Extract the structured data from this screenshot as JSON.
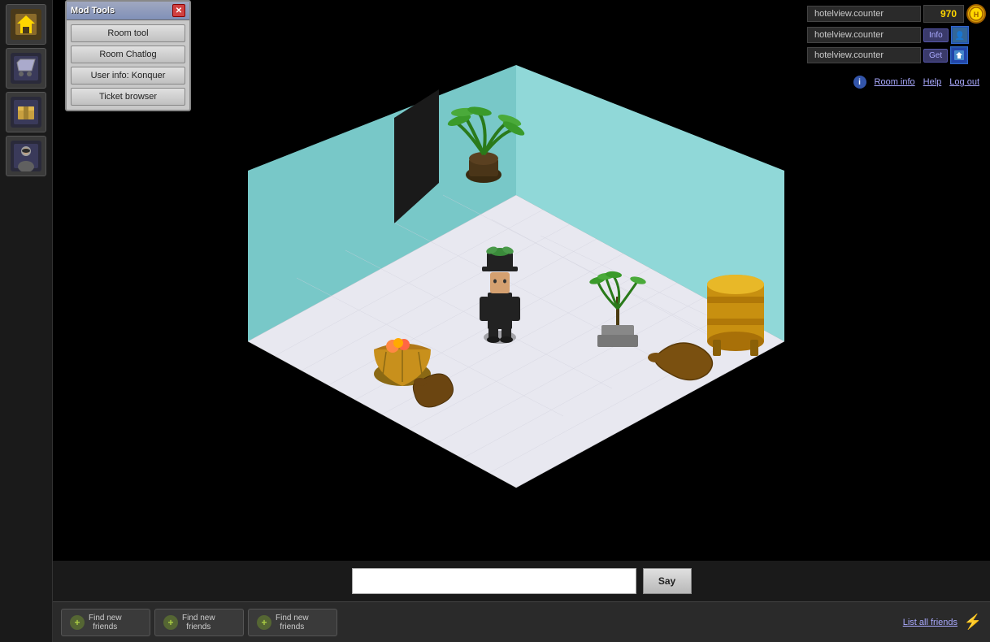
{
  "sidebar": {
    "icons": [
      {
        "name": "home-icon",
        "symbol": "🏠"
      },
      {
        "name": "shop-icon",
        "symbol": "🛒"
      },
      {
        "name": "inventory-icon",
        "symbol": "📦"
      },
      {
        "name": "avatar-icon",
        "symbol": "👤"
      }
    ]
  },
  "mod_tools": {
    "title": "Mod Tools",
    "close_label": "✕",
    "buttons": [
      {
        "name": "room-tool-btn",
        "label": "Room tool"
      },
      {
        "name": "room-chatlog-btn",
        "label": "Room Chatlog"
      },
      {
        "name": "user-info-btn",
        "label": "User info: Konquer"
      },
      {
        "name": "ticket-browser-btn",
        "label": "Ticket browser"
      }
    ]
  },
  "top_hud": {
    "username": "hotelview.counter",
    "credits": "970",
    "info_row": {
      "username": "hotelview.counter",
      "action": "Info"
    },
    "get_row": {
      "username": "hotelview.counter",
      "action": "Get"
    }
  },
  "room_info_bar": {
    "info_link": "Room info",
    "help_link": "Help",
    "logout_link": "Log out"
  },
  "chat": {
    "input_placeholder": "",
    "say_label": "Say"
  },
  "bottom_bar": {
    "find_friends_label": "Find new\nfriends",
    "list_all_label": "List all friends",
    "buttons": [
      {
        "name": "find-friends-1",
        "label": "Find new\nfriends"
      },
      {
        "name": "find-friends-2",
        "label": "Find new\nfriends"
      },
      {
        "name": "find-friends-3",
        "label": "Find new\nfriends"
      }
    ]
  }
}
